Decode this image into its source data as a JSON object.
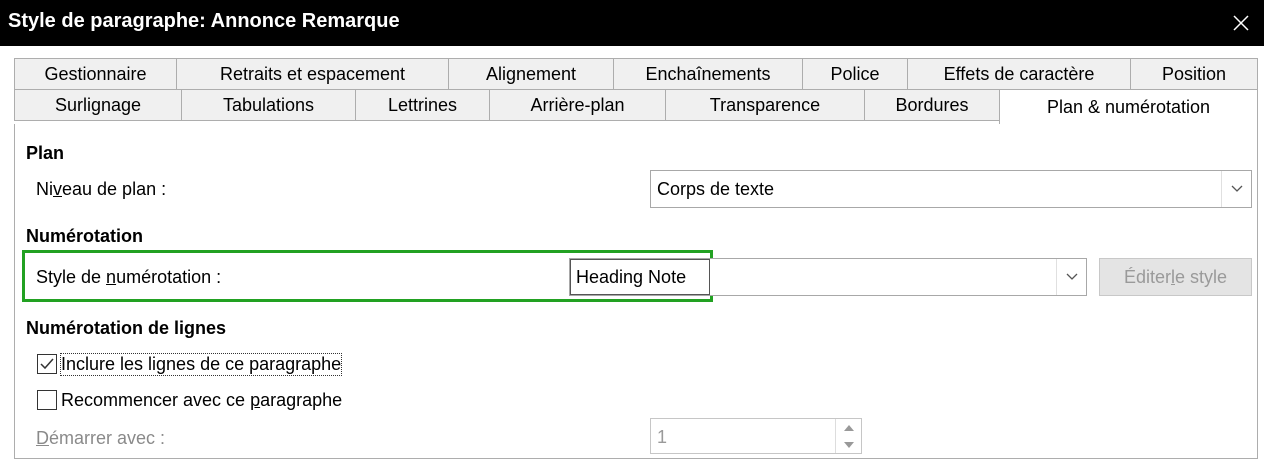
{
  "window": {
    "title": "Style de paragraphe: Annonce Remarque",
    "close_icon": "close-icon"
  },
  "tabs": {
    "row1": [
      "Gestionnaire",
      "Retraits et espacement",
      "Alignement",
      "Enchaînements",
      "Police",
      "Effets de caractère",
      "Position"
    ],
    "row2": [
      "Surlignage",
      "Tabulations",
      "Lettrines",
      "Arrière-plan",
      "Transparence",
      "Bordures",
      "Plan & numérotation"
    ],
    "selected": "Plan & numérotation"
  },
  "plan": {
    "heading": "Plan",
    "level_label_pre": "Ni",
    "level_label_u": "v",
    "level_label_post": "eau de plan :",
    "level_value": "Corps de texte"
  },
  "numbering": {
    "heading": "Numérotation",
    "style_label_pre": "Style de ",
    "style_label_u": "n",
    "style_label_post": "umérotation :",
    "style_value": "Heading Note",
    "edit_pre": "Éditer ",
    "edit_u": "l",
    "edit_post": "e style",
    "highlight_color": "#22a122"
  },
  "line_numbering": {
    "heading": "Numérotation de lignes",
    "include_label": "Inclure les lignes de ce paragraphe",
    "include_checked": true,
    "restart_label_pre": "Recommencer avec ce ",
    "restart_label_u": "p",
    "restart_label_post": "aragraphe",
    "restart_checked": false,
    "start_label_u": "D",
    "start_label_post": "émarrer avec :",
    "start_value": "1"
  }
}
